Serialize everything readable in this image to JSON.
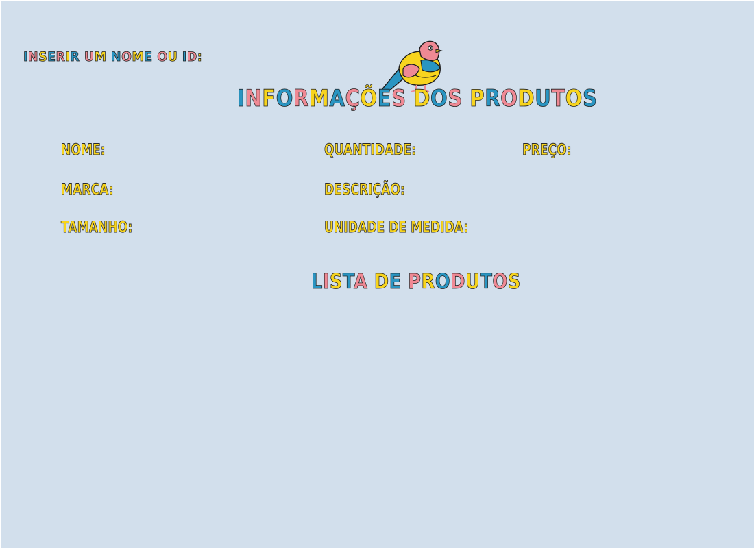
{
  "search": {
    "label": "Inserir um nome ou ID:",
    "value": "",
    "placeholder": ""
  },
  "header": {
    "title": "Informações dos Produtos",
    "mascot_icon": "bird-icon"
  },
  "fields": {
    "nome": {
      "label": "NOME:",
      "value": ""
    },
    "marca": {
      "label": "MARCA:",
      "value": ""
    },
    "tamanho": {
      "label": "TAMANHO:",
      "value": ""
    },
    "quantidade": {
      "label": "QUANTIDADE:",
      "value": ""
    },
    "descricao": {
      "label": "DESCRIÇÃO:",
      "value": ""
    },
    "unidade": {
      "label": "UNIDADE DE MEDIDA:",
      "value": ""
    },
    "preco": {
      "label": "PREÇO:",
      "value": ""
    }
  },
  "product_list": {
    "title": "Lista de Produtos",
    "items": []
  },
  "colors": {
    "background": "#d2dfec",
    "blue": "#2a95c2",
    "pink": "#ef8994",
    "yellow": "#f7d41e",
    "outline": "#1c1c1c"
  }
}
